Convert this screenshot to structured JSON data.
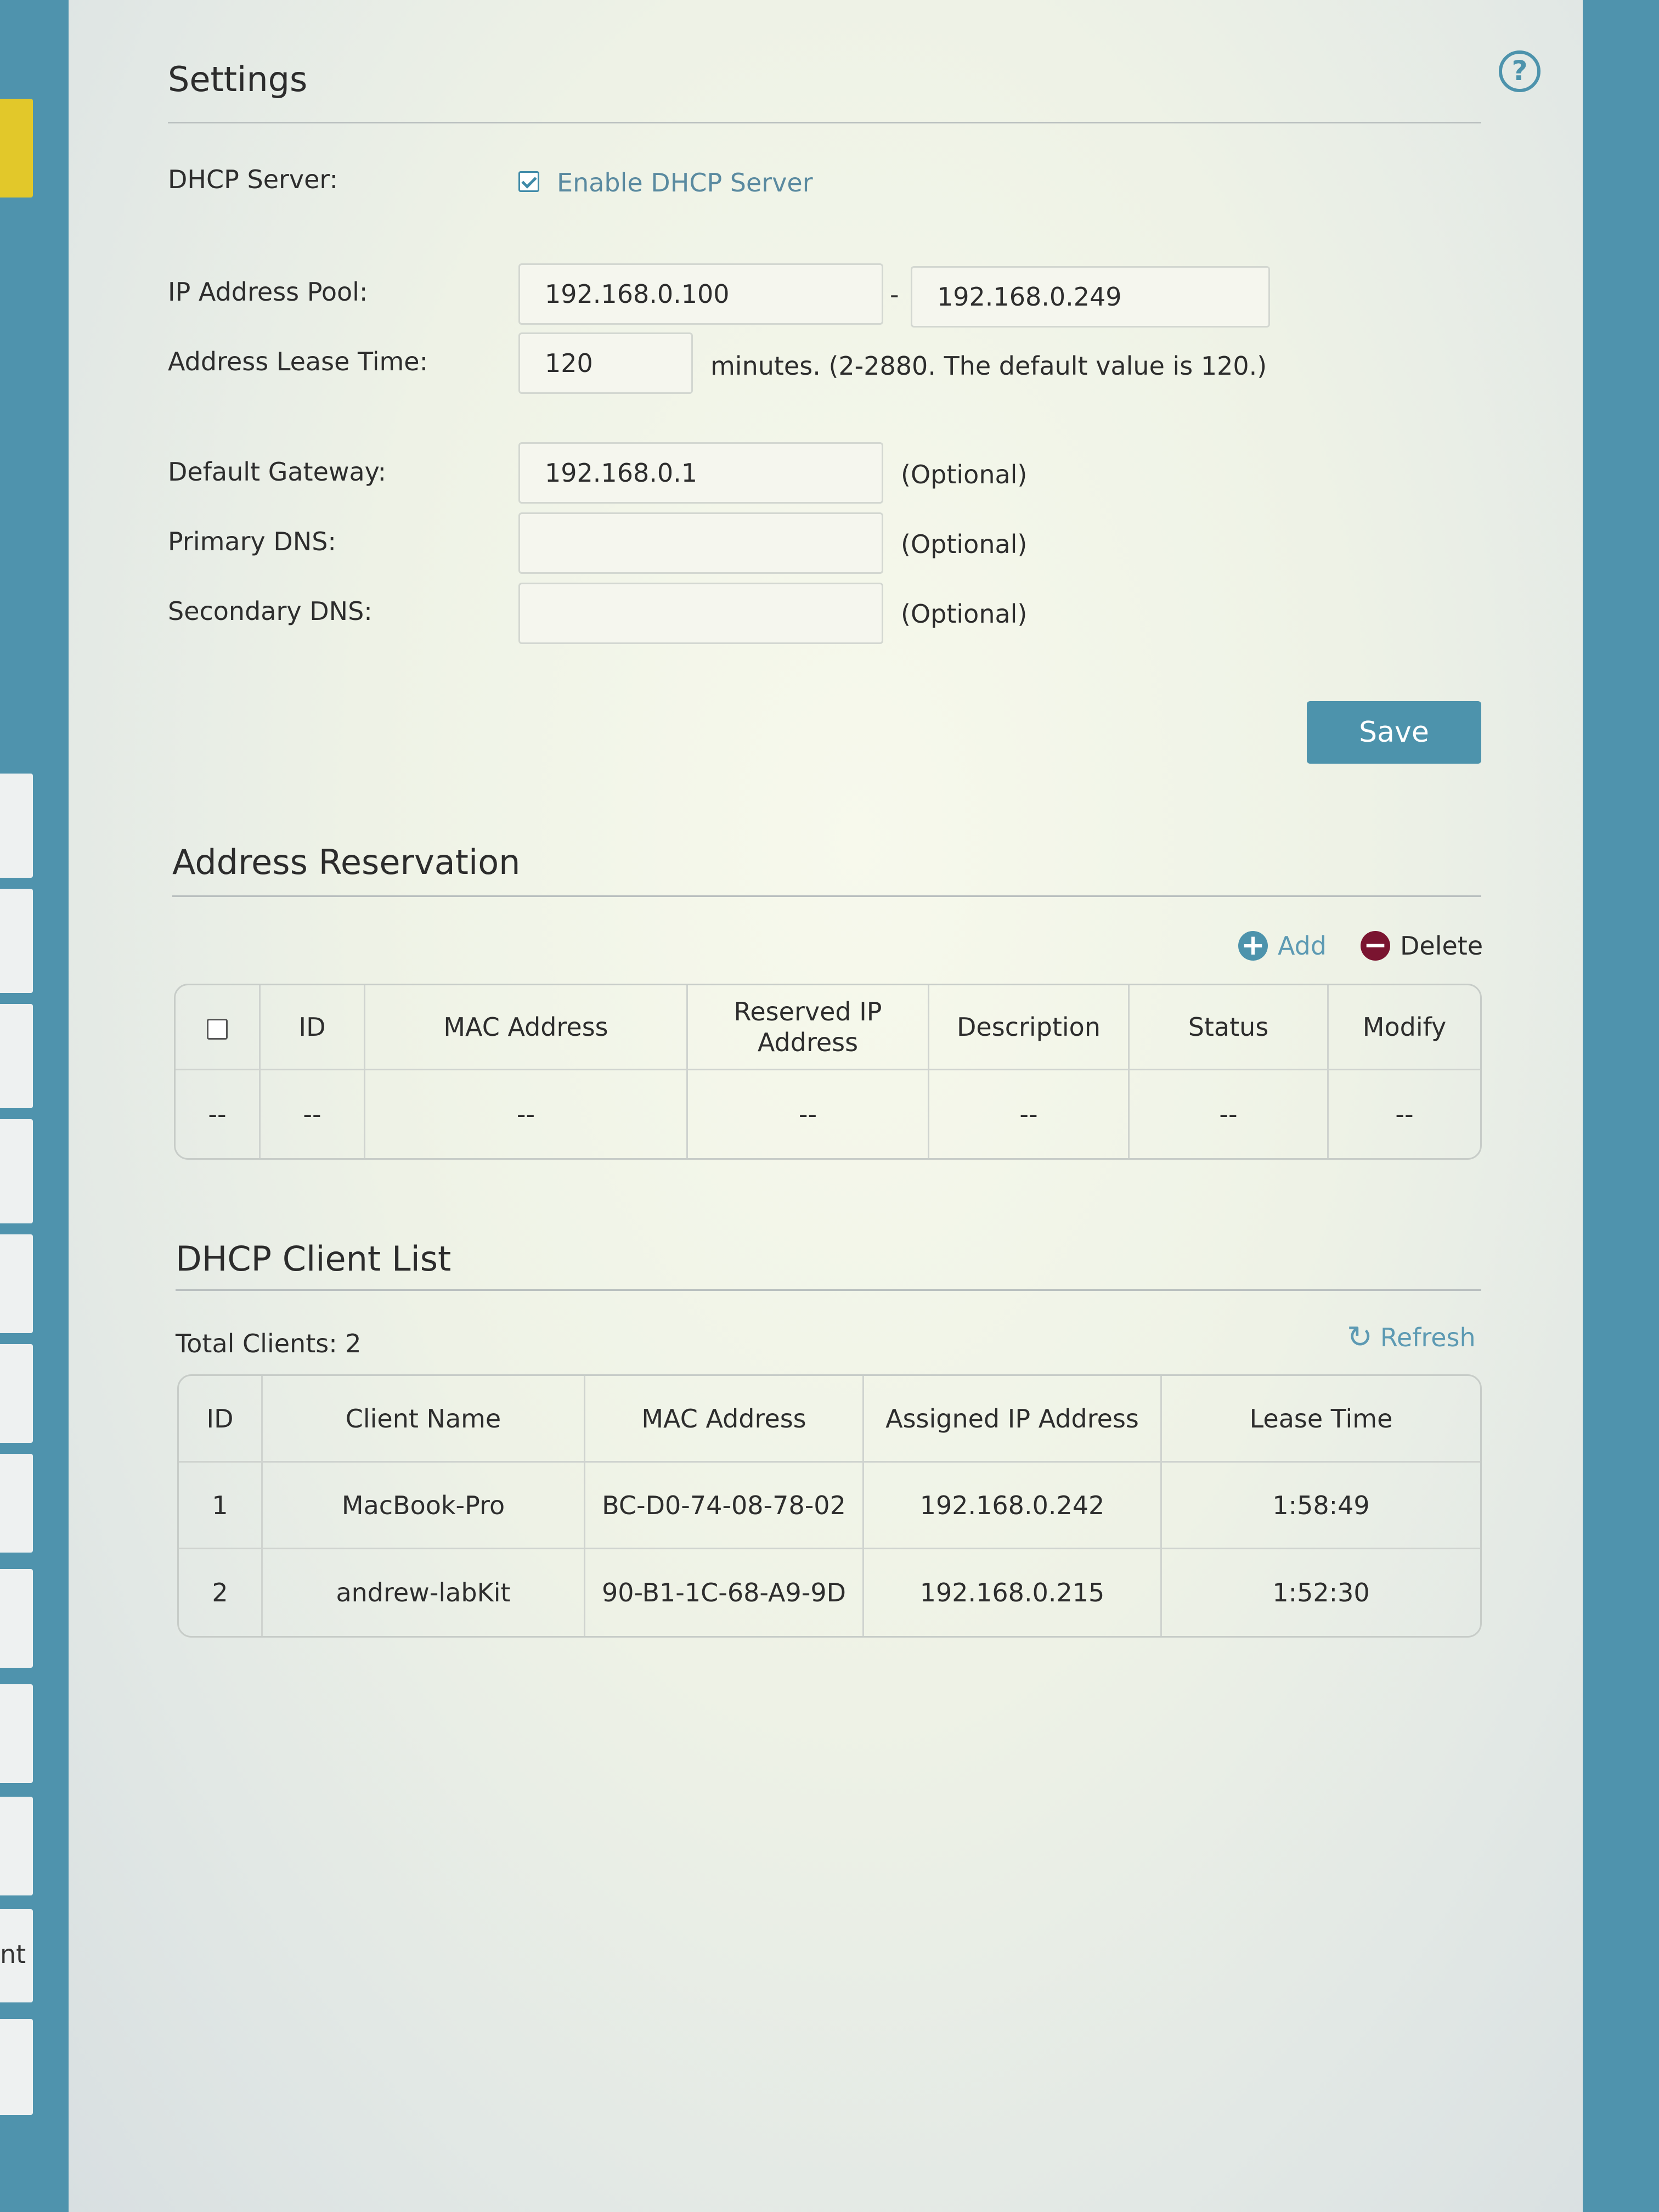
{
  "sidebar": {
    "partial_item_text": "nt"
  },
  "settings": {
    "title": "Settings",
    "dhcp_server_label": "DHCP Server:",
    "enable_dhcp_label": "Enable DHCP Server",
    "enable_dhcp_checked": true,
    "ip_pool_label": "IP Address Pool:",
    "ip_pool_start": "192.168.0.100",
    "ip_pool_separator": "-",
    "ip_pool_end": "192.168.0.249",
    "lease_time_label": "Address Lease Time:",
    "lease_time_value": "120",
    "lease_time_hint": "minutes. (2-2880. The default value is 120.)",
    "gateway_label": "Default Gateway:",
    "gateway_value": "192.168.0.1",
    "primary_dns_label": "Primary DNS:",
    "primary_dns_value": "",
    "secondary_dns_label": "Secondary DNS:",
    "secondary_dns_value": "",
    "optional_text": "(Optional)",
    "save_label": "Save"
  },
  "reservation": {
    "title": "Address Reservation",
    "add_label": "Add",
    "delete_label": "Delete",
    "columns": [
      "ID",
      "MAC Address",
      "Reserved IP Address",
      "Description",
      "Status",
      "Modify"
    ],
    "empty_row": [
      "--",
      "--",
      "--",
      "--",
      "--",
      "--",
      "--"
    ]
  },
  "client_list": {
    "title": "DHCP Client List",
    "total_label": "Total Clients: 2",
    "refresh_label": "Refresh",
    "columns": [
      "ID",
      "Client Name",
      "MAC Address",
      "Assigned IP Address",
      "Lease Time"
    ],
    "rows": [
      [
        "1",
        "MacBook-Pro",
        "BC-D0-74-08-78-02",
        "192.168.0.242",
        "1:58:49"
      ],
      [
        "2",
        "andrew-labKit",
        "90-B1-1C-68-A9-9D",
        "192.168.0.215",
        "1:52:30"
      ]
    ]
  },
  "icons": {
    "help": "help-circle-icon",
    "add": "plus-circle-icon",
    "delete": "minus-circle-icon",
    "refresh": "refresh-icon"
  },
  "colors": {
    "accent": "#4d93ac",
    "add_icon": "#4d93ac",
    "delete_icon": "#7a1430",
    "page_background": "#4f93ad"
  }
}
